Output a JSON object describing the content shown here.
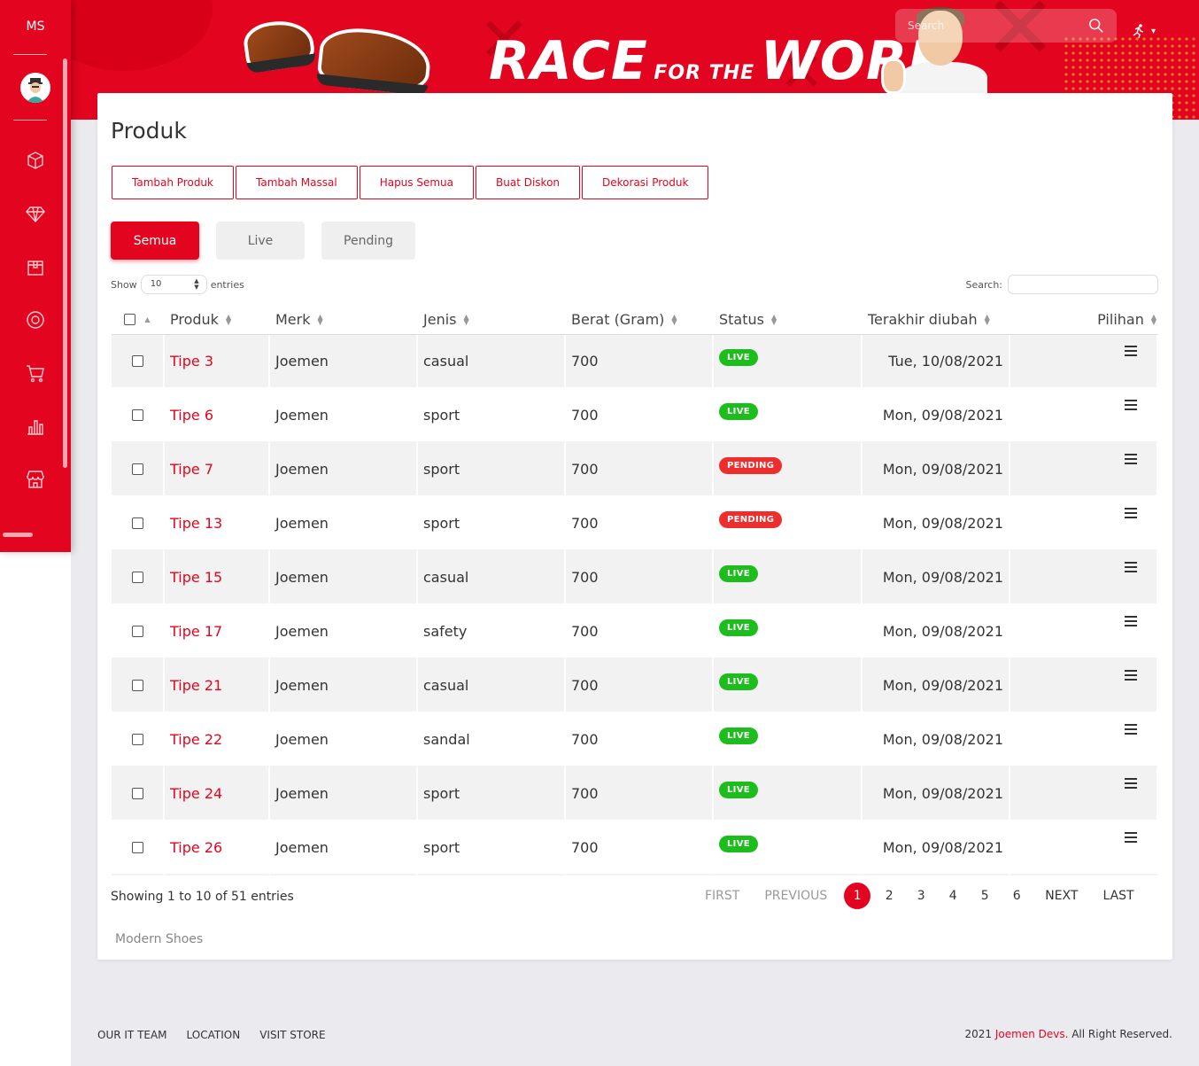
{
  "colors": {
    "accent": "#e3051f",
    "live": "#1cbd1c",
    "pending": "#ee2d2d"
  },
  "sidebar": {
    "brand": "MS",
    "icons": [
      "box-icon",
      "diamond-icon",
      "bag-icon",
      "at-icon",
      "cart-icon",
      "chart-icon",
      "store-icon"
    ]
  },
  "header": {
    "banner_race": "RACE",
    "banner_for_the": "FOR THE",
    "banner_work": "WORK",
    "search_placeholder": "Search"
  },
  "page": {
    "title": "Produk",
    "actions": [
      "Tambah Produk",
      "Tambah Massal",
      "Hapus Semua",
      "Buat Diskon",
      "Dekorasi Produk"
    ],
    "tabs": [
      "Semua",
      "Live",
      "Pending"
    ],
    "length_label_pre": "Show",
    "length_value": "10",
    "length_label_post": "entries",
    "search_label": "Search:"
  },
  "table": {
    "columns": [
      "Produk",
      "Merk",
      "Jenis",
      "Berat (Gram)",
      "Status",
      "Terakhir diubah",
      "Pilihan"
    ],
    "rows": [
      {
        "produk": "Tipe 3",
        "merk": "Joemen",
        "jenis": "casual",
        "berat": "700",
        "status": "LIVE",
        "date": "Tue, 10/08/2021"
      },
      {
        "produk": "Tipe 6",
        "merk": "Joemen",
        "jenis": "sport",
        "berat": "700",
        "status": "LIVE",
        "date": "Mon, 09/08/2021"
      },
      {
        "produk": "Tipe 7",
        "merk": "Joemen",
        "jenis": "sport",
        "berat": "700",
        "status": "PENDING",
        "date": "Mon, 09/08/2021"
      },
      {
        "produk": "Tipe 13",
        "merk": "Joemen",
        "jenis": "sport",
        "berat": "700",
        "status": "PENDING",
        "date": "Mon, 09/08/2021"
      },
      {
        "produk": "Tipe 15",
        "merk": "Joemen",
        "jenis": "casual",
        "berat": "700",
        "status": "LIVE",
        "date": "Mon, 09/08/2021"
      },
      {
        "produk": "Tipe 17",
        "merk": "Joemen",
        "jenis": "safety",
        "berat": "700",
        "status": "LIVE",
        "date": "Mon, 09/08/2021"
      },
      {
        "produk": "Tipe 21",
        "merk": "Joemen",
        "jenis": "casual",
        "berat": "700",
        "status": "LIVE",
        "date": "Mon, 09/08/2021"
      },
      {
        "produk": "Tipe 22",
        "merk": "Joemen",
        "jenis": "sandal",
        "berat": "700",
        "status": "LIVE",
        "date": "Mon, 09/08/2021"
      },
      {
        "produk": "Tipe 24",
        "merk": "Joemen",
        "jenis": "sport",
        "berat": "700",
        "status": "LIVE",
        "date": "Mon, 09/08/2021"
      },
      {
        "produk": "Tipe 26",
        "merk": "Joemen",
        "jenis": "sport",
        "berat": "700",
        "status": "LIVE",
        "date": "Mon, 09/08/2021"
      }
    ]
  },
  "pagination": {
    "info": "Showing 1 to 10 of 51 entries",
    "first": "FIRST",
    "previous": "PREVIOUS",
    "pages": [
      "1",
      "2",
      "3",
      "4",
      "5",
      "6"
    ],
    "current": "1",
    "next": "NEXT",
    "last": "LAST"
  },
  "card_footer": "Modern Shoes",
  "footer": {
    "links": [
      "OUR IT TEAM",
      "LOCATION",
      "VISIT STORE"
    ],
    "copyright_pre": "2021 ",
    "copyright_brand": "Joemen Devs.",
    "copyright_post": " All Right Reserved."
  }
}
